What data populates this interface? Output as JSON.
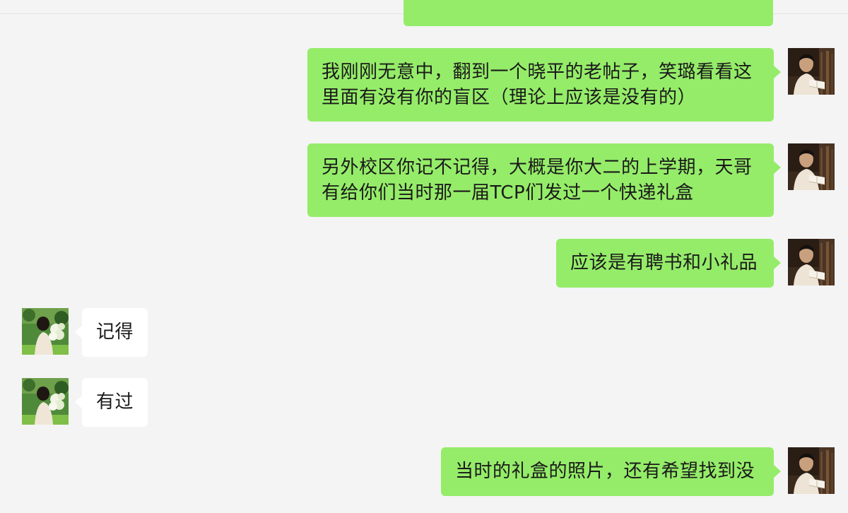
{
  "colors": {
    "background": "#f4f4f4",
    "self_bubble": "#95ec69",
    "other_bubble": "#ffffff"
  },
  "messages": [
    {
      "sender": "self",
      "avatar_icon": "man-reading-book-avatar",
      "lines": [
        "我刚刚无意中，翻到一个晓平的老帖子，笑璐看看这",
        "里面有没有你的盲区（理论上应该是没有的）"
      ]
    },
    {
      "sender": "self",
      "avatar_icon": "man-reading-book-avatar",
      "lines": [
        "另外校区你记不记得，大概是你大二的上学期，天哥",
        "有给你们当时那一届TCP们发过一个快递礼盒"
      ]
    },
    {
      "sender": "self",
      "avatar_icon": "man-reading-book-avatar",
      "lines": [
        "应该是有聘书和小礼品"
      ]
    },
    {
      "sender": "other",
      "avatar_icon": "girl-with-flowers-avatar",
      "lines": [
        "记得"
      ]
    },
    {
      "sender": "other",
      "avatar_icon": "girl-with-flowers-avatar",
      "lines": [
        "有过"
      ]
    },
    {
      "sender": "self",
      "avatar_icon": "man-reading-book-avatar",
      "lines": [
        "当时的礼盒的照片，还有希望找到没"
      ]
    }
  ]
}
